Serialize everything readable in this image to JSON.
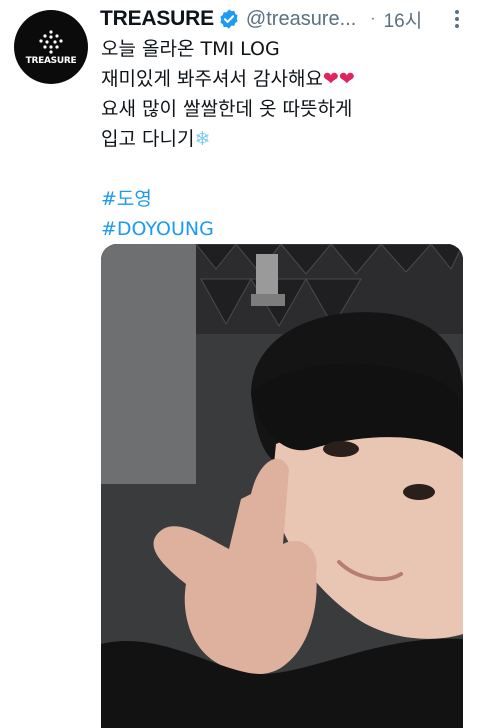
{
  "tweet": {
    "avatar": {
      "logo_text": "TREASURE"
    },
    "author": {
      "display_name": "TREASURE",
      "handle": "@treasure...",
      "verified_icon": "verified-badge-icon"
    },
    "separator": "·",
    "timestamp": "16시",
    "more_icon": "more-vertical-icon",
    "text_lines": [
      "오늘 올라온 TMI LOG",
      "재미있게 봐주셔서 감사해요❤❤",
      "요새 많이 쌀쌀한데 옷 따뜻하게",
      "입고 다니기❄"
    ],
    "hashtags": [
      "#도영",
      "#DOYOUNG"
    ],
    "photo": {
      "description_icon": "selfie-photo"
    }
  },
  "colors": {
    "accent": "#1d9bf0",
    "text": "#0f1419",
    "secondary": "#5b7083",
    "heart": "#e0245e",
    "snowflake": "#7ccbf2"
  }
}
